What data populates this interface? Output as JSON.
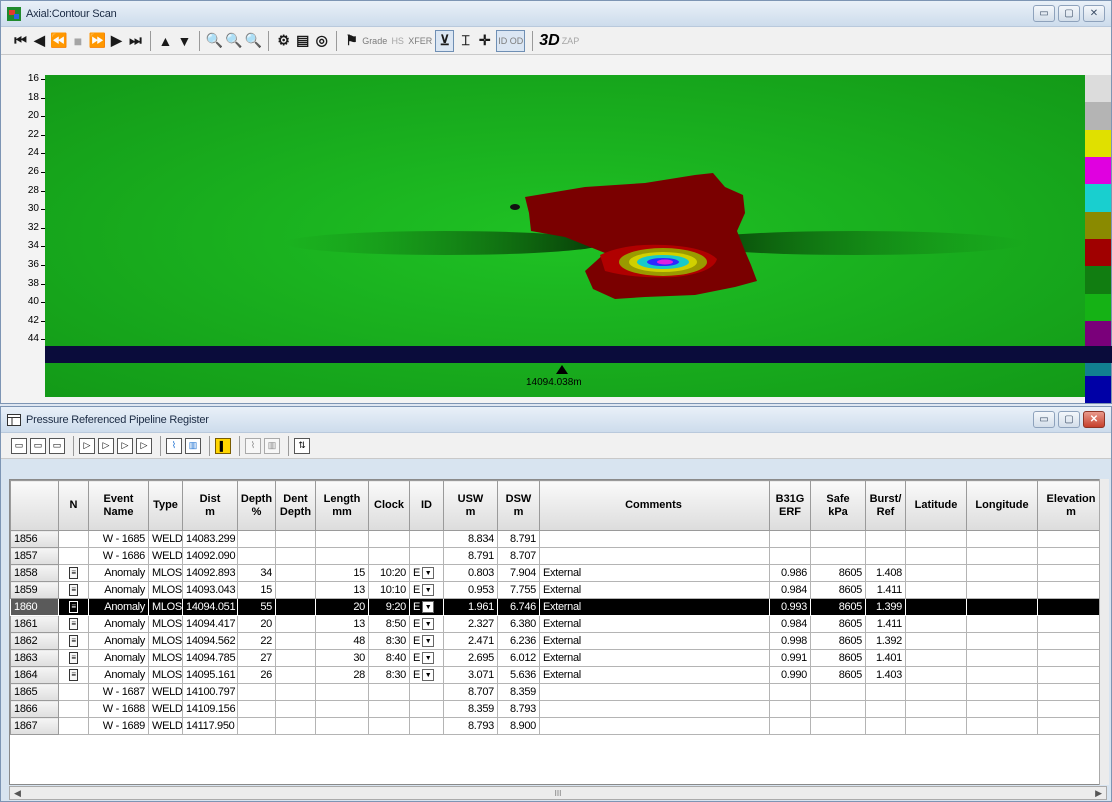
{
  "scan_window": {
    "title": "Axial:Contour Scan",
    "toolbar": [
      "|◀",
      "◀",
      "◀◀",
      "■",
      "▶▶",
      "▶",
      "▶|",
      "▲",
      "▼",
      "zoom-in",
      "zoom-out",
      "zoom-fit",
      "pipe",
      "grade-A",
      "palette",
      "pin",
      "Grade",
      "HS",
      "XFER",
      "align",
      "depth",
      "crosshair",
      "ID OD",
      "3D",
      "ZAP"
    ],
    "toolbar_text": {
      "grade": "Grade",
      "hs": "HS",
      "xfer": "XFER",
      "idod": "ID OD",
      "three_d": "3D",
      "zap": "ZAP"
    },
    "ruler_labels": [
      "16",
      "18",
      "20",
      "22",
      "24",
      "26",
      "28",
      "30",
      "32",
      "34",
      "36",
      "38",
      "40",
      "42",
      "44"
    ],
    "position_label": "14094.038m",
    "palette_colors": [
      "#dcdcdc",
      "#b4b4b4",
      "#e0e000",
      "#e000e0",
      "#19cfcf",
      "#8a8a00",
      "#a00000",
      "#117d11",
      "#15b215",
      "#7a007a",
      "#117f90",
      "#0000a6"
    ]
  },
  "register_window": {
    "title": "Pressure Referenced Pipeline Register",
    "columns": [
      {
        "l1": "",
        "l2": ""
      },
      {
        "l1": "N",
        "l2": ""
      },
      {
        "l1": "Event",
        "l2": "Name"
      },
      {
        "l1": "Type",
        "l2": ""
      },
      {
        "l1": "Dist",
        "l2": "m"
      },
      {
        "l1": "Depth",
        "l2": "%"
      },
      {
        "l1": "Dent",
        "l2": "Depth"
      },
      {
        "l1": "Length",
        "l2": "mm"
      },
      {
        "l1": "Clock",
        "l2": ""
      },
      {
        "l1": "ID",
        "l2": ""
      },
      {
        "l1": "USW",
        "l2": "m"
      },
      {
        "l1": "DSW",
        "l2": "m"
      },
      {
        "l1": "Comments",
        "l2": ""
      },
      {
        "l1": "B31G",
        "l2": "ERF"
      },
      {
        "l1": "Safe",
        "l2": "kPa"
      },
      {
        "l1": "Burst/",
        "l2": "Ref"
      },
      {
        "l1": "Latitude",
        "l2": ""
      },
      {
        "l1": "Longitude",
        "l2": ""
      },
      {
        "l1": "Elevation",
        "l2": "m"
      }
    ],
    "rows": [
      {
        "rn": "1856",
        "n": "",
        "event": "W - 1685",
        "type": "WELD",
        "dist": "14083.299",
        "depth": "",
        "dent": "",
        "length": "",
        "clock": "",
        "id": "",
        "usw": "8.834",
        "dsw": "8.791",
        "comments": "",
        "b31g": "",
        "safe": "",
        "burst": "",
        "lat": "",
        "lon": "",
        "elev": ""
      },
      {
        "rn": "1857",
        "n": "",
        "event": "W - 1686",
        "type": "WELD",
        "dist": "14092.090",
        "depth": "",
        "dent": "",
        "length": "",
        "clock": "",
        "id": "",
        "usw": "8.791",
        "dsw": "8.707",
        "comments": "",
        "b31g": "",
        "safe": "",
        "burst": "",
        "lat": "",
        "lon": "",
        "elev": ""
      },
      {
        "rn": "1858",
        "n": "icon",
        "event": "Anomaly",
        "type": "MLOS",
        "dist": "14092.893",
        "depth": "34",
        "dent": "",
        "length": "15",
        "clock": "10:20",
        "id": "E",
        "usw": "0.803",
        "dsw": "7.904",
        "comments": "External",
        "b31g": "0.986",
        "safe": "8605",
        "burst": "1.408",
        "lat": "",
        "lon": "",
        "elev": ""
      },
      {
        "rn": "1859",
        "n": "icon",
        "event": "Anomaly",
        "type": "MLOS",
        "dist": "14093.043",
        "depth": "15",
        "dent": "",
        "length": "13",
        "clock": "10:10",
        "id": "E",
        "usw": "0.953",
        "dsw": "7.755",
        "comments": "External",
        "b31g": "0.984",
        "safe": "8605",
        "burst": "1.411",
        "lat": "",
        "lon": "",
        "elev": ""
      },
      {
        "rn": "1860",
        "n": "icon",
        "event": "Anomaly",
        "type": "MLOS",
        "dist": "14094.051",
        "depth": "55",
        "dent": "",
        "length": "20",
        "clock": "9:20",
        "id": "E",
        "usw": "1.961",
        "dsw": "6.746",
        "comments": "External",
        "b31g": "0.993",
        "safe": "8605",
        "burst": "1.399",
        "lat": "",
        "lon": "",
        "elev": "",
        "selected": true
      },
      {
        "rn": "1861",
        "n": "icon",
        "event": "Anomaly",
        "type": "MLOS",
        "dist": "14094.417",
        "depth": "20",
        "dent": "",
        "length": "13",
        "clock": "8:50",
        "id": "E",
        "usw": "2.327",
        "dsw": "6.380",
        "comments": "External",
        "b31g": "0.984",
        "safe": "8605",
        "burst": "1.411",
        "lat": "",
        "lon": "",
        "elev": ""
      },
      {
        "rn": "1862",
        "n": "icon",
        "event": "Anomaly",
        "type": "MLOS",
        "dist": "14094.562",
        "depth": "22",
        "dent": "",
        "length": "48",
        "clock": "8:30",
        "id": "E",
        "usw": "2.471",
        "dsw": "6.236",
        "comments": "External",
        "b31g": "0.998",
        "safe": "8605",
        "burst": "1.392",
        "lat": "",
        "lon": "",
        "elev": ""
      },
      {
        "rn": "1863",
        "n": "icon",
        "event": "Anomaly",
        "type": "MLOS",
        "dist": "14094.785",
        "depth": "27",
        "dent": "",
        "length": "30",
        "clock": "8:40",
        "id": "E",
        "usw": "2.695",
        "dsw": "6.012",
        "comments": "External",
        "b31g": "0.991",
        "safe": "8605",
        "burst": "1.401",
        "lat": "",
        "lon": "",
        "elev": ""
      },
      {
        "rn": "1864",
        "n": "icon",
        "event": "Anomaly",
        "type": "MLOS",
        "dist": "14095.161",
        "depth": "26",
        "dent": "",
        "length": "28",
        "clock": "8:30",
        "id": "E",
        "usw": "3.071",
        "dsw": "5.636",
        "comments": "External",
        "b31g": "0.990",
        "safe": "8605",
        "burst": "1.403",
        "lat": "",
        "lon": "",
        "elev": ""
      },
      {
        "rn": "1865",
        "n": "",
        "event": "W - 1687",
        "type": "WELD",
        "dist": "14100.797",
        "depth": "",
        "dent": "",
        "length": "",
        "clock": "",
        "id": "",
        "usw": "8.707",
        "dsw": "8.359",
        "comments": "",
        "b31g": "",
        "safe": "",
        "burst": "",
        "lat": "",
        "lon": "",
        "elev": ""
      },
      {
        "rn": "1866",
        "n": "",
        "event": "W - 1688",
        "type": "WELD",
        "dist": "14109.156",
        "depth": "",
        "dent": "",
        "length": "",
        "clock": "",
        "id": "",
        "usw": "8.359",
        "dsw": "8.793",
        "comments": "",
        "b31g": "",
        "safe": "",
        "burst": "",
        "lat": "",
        "lon": "",
        "elev": ""
      },
      {
        "rn": "1867",
        "n": "",
        "event": "W - 1689",
        "type": "WELD",
        "dist": "14117.950",
        "depth": "",
        "dent": "",
        "length": "",
        "clock": "",
        "id": "",
        "usw": "8.793",
        "dsw": "8.900",
        "comments": "",
        "b31g": "",
        "safe": "",
        "burst": "",
        "lat": "",
        "lon": "",
        "elev": ""
      }
    ],
    "hscroll_label": "III"
  },
  "colors": {
    "field_green": "#19b21f",
    "selection": "#000000",
    "anomaly_red": "#7a0000"
  }
}
